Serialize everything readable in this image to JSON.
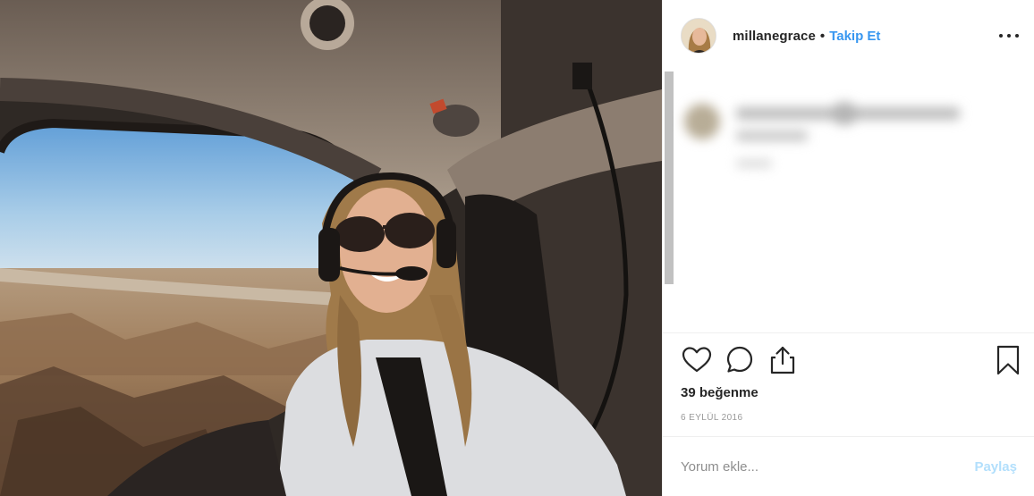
{
  "post": {
    "photo_alt": "Selfie in helicopter cockpit above a canyon",
    "header": {
      "username": "millanegrace",
      "separator": "•",
      "follow_label": "Takip Et",
      "more_icon": "more-options-icon"
    },
    "actions": {
      "like_icon": "heart-icon",
      "comment_icon": "comment-bubble-icon",
      "share_icon": "share-icon",
      "save_icon": "bookmark-icon"
    },
    "likes_text": "39 beğenme",
    "date_text": "6 EYLÜL 2016",
    "comment_box": {
      "placeholder": "Yorum ekle...",
      "post_label": "Paylaş"
    }
  },
  "colors": {
    "accent_link": "#3897f0",
    "post_disabled": "#b2dffc",
    "muted_text": "#999999",
    "divider": "#efefef"
  }
}
